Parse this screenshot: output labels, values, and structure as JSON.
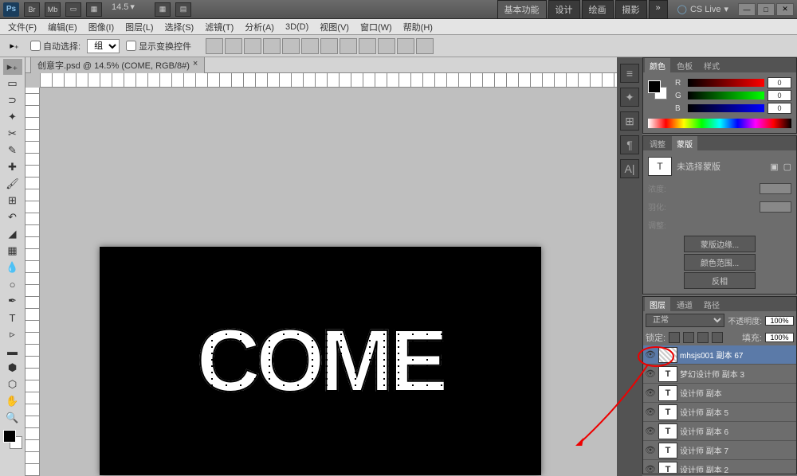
{
  "top": {
    "logo": "Ps",
    "icons": [
      "Br",
      "Mb"
    ],
    "zoom": "14.5",
    "workspaces": [
      "基本功能",
      "设计",
      "绘画",
      "摄影"
    ],
    "more": "»",
    "cslive": "CS Live",
    "winbtns": [
      "—",
      "□",
      "✕"
    ]
  },
  "menu": [
    "文件(F)",
    "编辑(E)",
    "图像(I)",
    "图层(L)",
    "选择(S)",
    "滤镜(T)",
    "分析(A)",
    "3D(D)",
    "视图(V)",
    "窗口(W)",
    "帮助(H)"
  ],
  "options": {
    "autoselect": "自动选择:",
    "group": "组",
    "transform": "显示变换控件"
  },
  "doc_tab": "创意字.psd @ 14.5% (COME, RGB/8#)",
  "artwork_text": "COME",
  "color_panel": {
    "tabs": [
      "颜色",
      "色板",
      "样式"
    ],
    "channels": [
      {
        "label": "R",
        "value": "0"
      },
      {
        "label": "G",
        "value": "0"
      },
      {
        "label": "B",
        "value": "0"
      }
    ]
  },
  "mask_panel": {
    "tabs": [
      "调整",
      "蒙版"
    ],
    "unselected": "未选择蒙版",
    "density": "浓度:",
    "feather": "羽化:",
    "tweak": "调整:",
    "btn_edge": "蒙版边缘...",
    "btn_range": "颜色范围...",
    "btn_invert": "反相"
  },
  "layers_panel": {
    "tabs": [
      "图层",
      "通道",
      "路径"
    ],
    "blend": "正常",
    "opacity_label": "不透明度:",
    "opacity": "100%",
    "lock_label": "锁定:",
    "fill_label": "填充:",
    "fill": "100%",
    "layers": [
      {
        "name": "mhsjs001 副本 67",
        "type": "img",
        "active": true
      },
      {
        "name": "梦幻设计师 副本 3",
        "type": "T"
      },
      {
        "name": "设计师 副本",
        "type": "T"
      },
      {
        "name": "设计师 副本 5",
        "type": "T"
      },
      {
        "name": "设计师 副本 6",
        "type": "T"
      },
      {
        "name": "设计师 副本 7",
        "type": "T"
      },
      {
        "name": "设计师 副本 2",
        "type": "T"
      }
    ]
  }
}
